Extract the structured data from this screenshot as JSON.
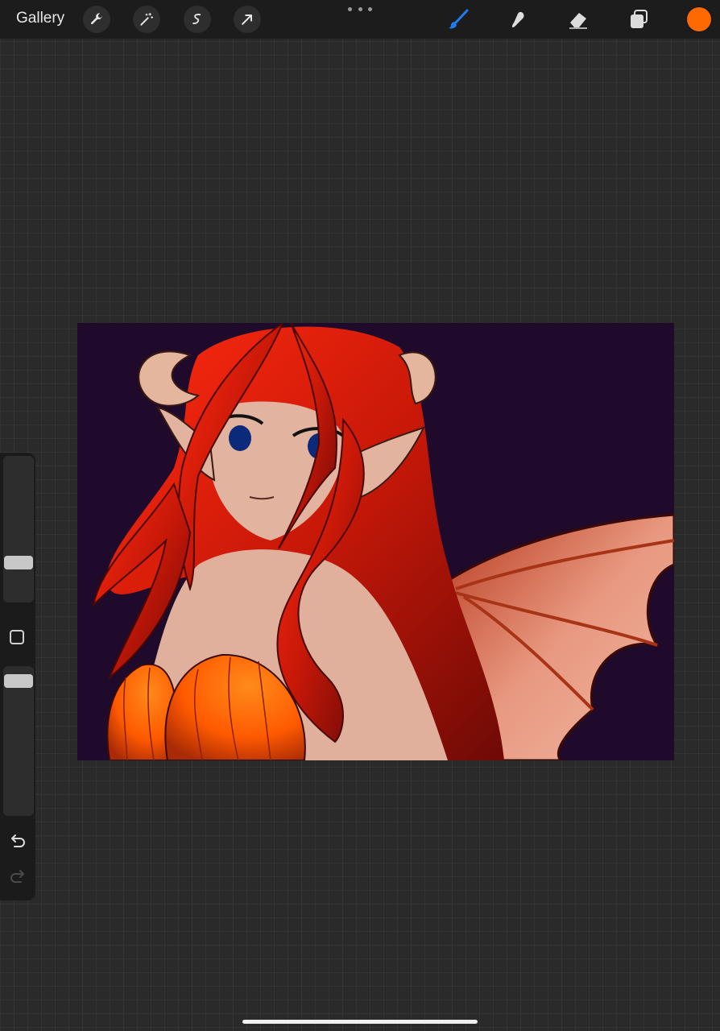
{
  "toolbar": {
    "gallery_label": "Gallery",
    "left_tools": [
      "wrench-icon",
      "magic-wand-icon",
      "selection-icon",
      "transform-arrow-icon"
    ],
    "right_tools": [
      "brush-icon",
      "smudge-icon",
      "eraser-icon",
      "layers-icon"
    ],
    "active_tool": "brush-icon",
    "accent_color": "#1e7cf0",
    "current_color": "#ff6a00"
  },
  "sidebar": {
    "brush_size_level": 0.26,
    "opacity_level": 0.96
  },
  "canvas": {
    "background_color": "#1f0a2b"
  }
}
